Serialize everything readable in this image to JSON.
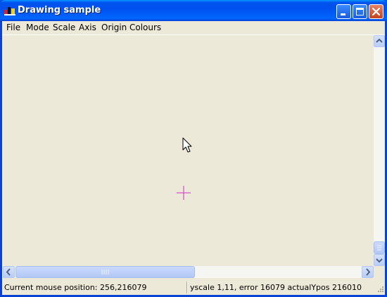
{
  "window": {
    "title": "Drawing sample"
  },
  "menu": {
    "items": [
      "File",
      "Mode",
      "Scale",
      "Axis",
      "Origin",
      "Colours"
    ]
  },
  "canvas": {
    "crosshair_color": "#d030c8",
    "background": "#ece9d8"
  },
  "statusbar": {
    "mouse_position": "Current mouse position: 256,216079",
    "scale_info": "yscale 1,11, error 16079 actualYpos 216010"
  },
  "colors": {
    "titlebar": "#0054e3",
    "close_button": "#e0532d"
  }
}
